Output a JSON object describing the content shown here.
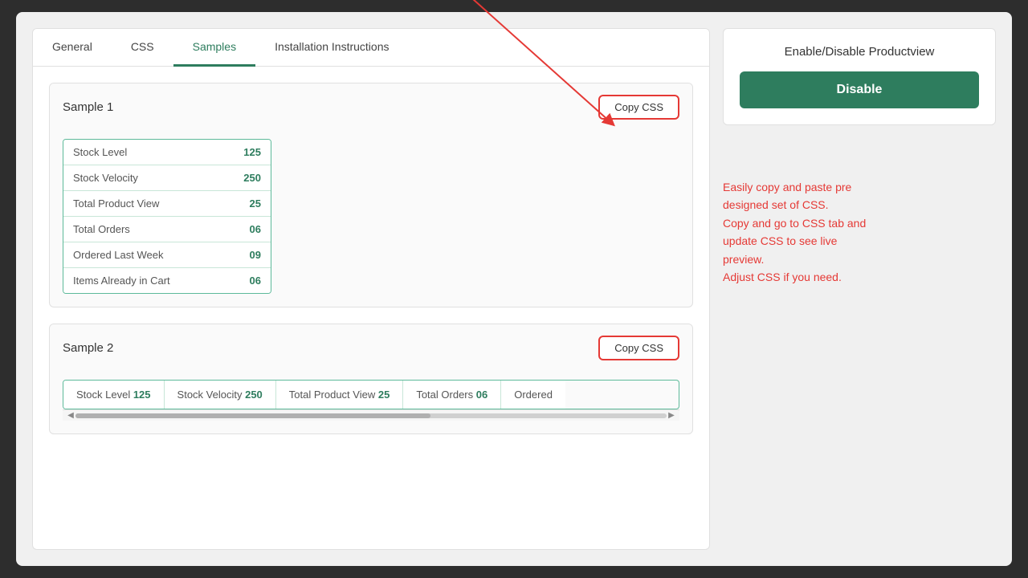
{
  "tabs": [
    {
      "id": "general",
      "label": "General",
      "active": false
    },
    {
      "id": "css",
      "label": "CSS",
      "active": false
    },
    {
      "id": "samples",
      "label": "Samples",
      "active": true
    },
    {
      "id": "installation",
      "label": "Installation Instructions",
      "active": false
    }
  ],
  "sample1": {
    "title": "Sample 1",
    "copy_button": "Copy CSS",
    "rows": [
      {
        "label": "Stock Level",
        "value": "125"
      },
      {
        "label": "Stock Velocity",
        "value": "250"
      },
      {
        "label": "Total Product View",
        "value": "25"
      },
      {
        "label": "Total Orders",
        "value": "06"
      },
      {
        "label": "Ordered Last Week",
        "value": "09"
      },
      {
        "label": "Items Already in Cart",
        "value": "06"
      }
    ]
  },
  "sample2": {
    "title": "Sample 2",
    "copy_button": "Copy CSS",
    "cells": [
      {
        "label": "Stock Level",
        "value": "125"
      },
      {
        "label": "Stock Velocity",
        "value": "250"
      },
      {
        "label": "Total Product View",
        "value": "25"
      },
      {
        "label": "Total Orders",
        "value": "06"
      },
      {
        "label": "Ordered",
        "value": ""
      }
    ]
  },
  "right_panel": {
    "enable_disable_title": "Enable/Disable Productview",
    "disable_button": "Disable",
    "annotation": "Easily copy and paste pre designed set of CSS.\nCopy and go to CSS tab and update CSS to see live preview.\nAdjust CSS if you need."
  }
}
